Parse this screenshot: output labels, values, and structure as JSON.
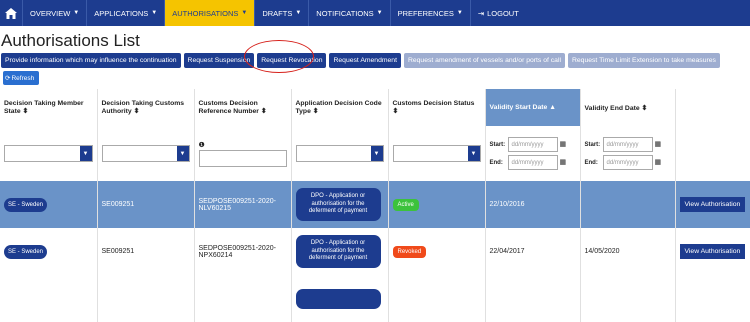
{
  "nav": {
    "items": [
      {
        "label": "OVERVIEW"
      },
      {
        "label": "APPLICATIONS"
      },
      {
        "label": "AUTHORISATIONS"
      },
      {
        "label": "DRAFTS"
      },
      {
        "label": "NOTIFICATIONS"
      },
      {
        "label": "PREFERENCES"
      },
      {
        "label": "LOGOUT"
      }
    ]
  },
  "title": "Authorisations List",
  "actions": [
    "Provide information which may influence the continuation",
    "Request Suspension",
    "Request Revocation",
    "Request Amendment",
    "Request amendment of vessels and/or ports of call",
    "Request Time Limit Extension to take measures"
  ],
  "refresh": "Refresh",
  "columns": [
    "Decision Taking Member State",
    "Decision Taking Customs Authority",
    "Customs Decision Reference Number",
    "Application Decision Code Type",
    "Customs Decision Status",
    "Validity Start Date",
    "Validity End Date"
  ],
  "filters": {
    "start": "Start:",
    "end": "End:",
    "placeholder": "dd/mm/yyyy"
  },
  "rows": [
    {
      "state": "SE - Sweden",
      "authority": "SE009251",
      "ref": "SEDPOSE009251-2020-NLV60215",
      "code": "DPO - Application or authorisation for the deferment of payment",
      "status": "Active",
      "start": "22/10/2016",
      "end": "",
      "action": "View Authorisation"
    },
    {
      "state": "SE - Sweden",
      "authority": "SE009251",
      "ref": "SEDPOSE009251-2020-NPX60214",
      "code": "DPO - Application or authorisation for the deferment of payment",
      "status": "Revoked",
      "start": "22/04/2017",
      "end": "14/05/2020",
      "action": "View Authorisation"
    }
  ]
}
